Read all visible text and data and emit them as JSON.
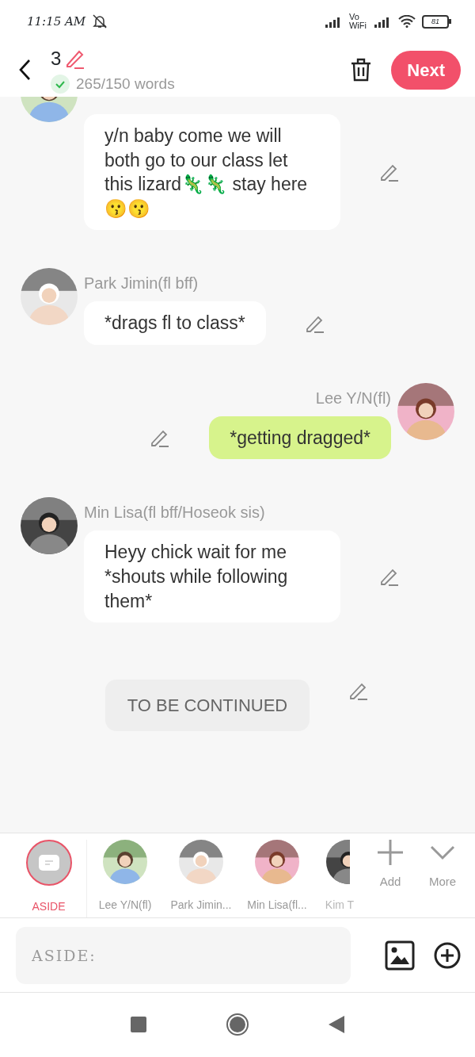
{
  "status_bar": {
    "time": "11:15 AM",
    "volte_top": "Vo",
    "volte_bottom": "WiFi",
    "battery": "81"
  },
  "header": {
    "part": "3",
    "word_count": "265/150 words",
    "word_goal_met": true,
    "next_button": "Next"
  },
  "messages": [
    {
      "kind": "left",
      "text": "y/n baby come we will both go to our class let this lizard🦎🦎 stay here😗😗"
    },
    {
      "kind": "left",
      "name": "Park Jimin(fl bff)",
      "text": "*drags fl to class*"
    },
    {
      "kind": "right",
      "name": "Lee Y/N(fl)",
      "text": "*getting dragged*"
    },
    {
      "kind": "left",
      "name": "Min Lisa(fl bff/Hoseok sis)",
      "text": "Heyy chick wait for me *shouts while following them*"
    },
    {
      "kind": "aside",
      "text": "TO BE CONTINUED"
    }
  ],
  "characters": [
    {
      "kind": "aside",
      "label": "ASIDE",
      "selected": true
    },
    {
      "kind": "character",
      "label": "Lee Y/N(fl)",
      "selected": false
    },
    {
      "kind": "character",
      "label": "Park Jimin...",
      "selected": false
    },
    {
      "kind": "character",
      "label": "Min Lisa(fl...",
      "selected": false
    },
    {
      "kind": "character",
      "label": "Kim T",
      "selected": false
    }
  ],
  "add_button": "Add",
  "more_button": "More",
  "composer": {
    "placeholder": "ASIDE:"
  }
}
